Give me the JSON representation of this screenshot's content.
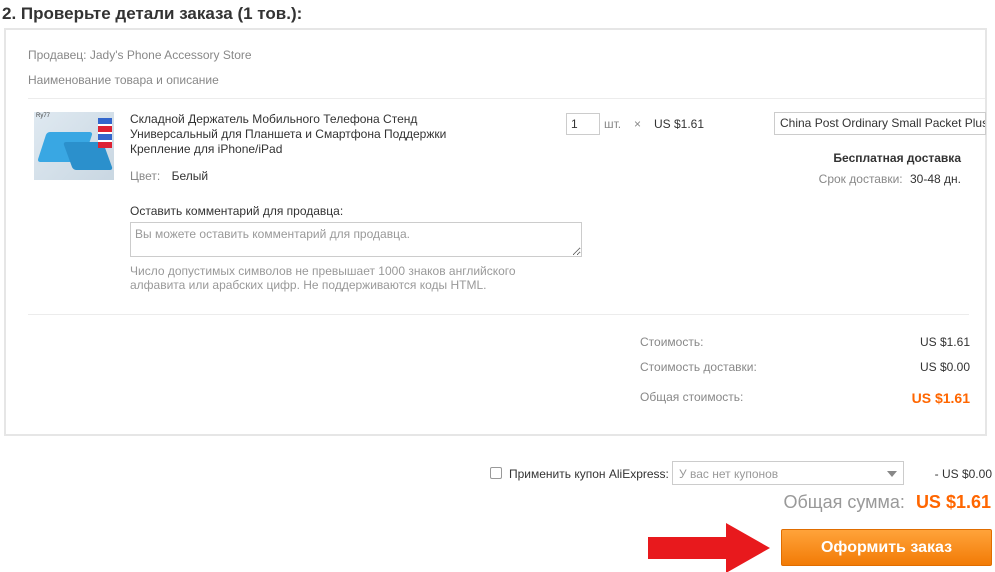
{
  "section": {
    "title": "2. Проверьте детали заказа (1 тов.):"
  },
  "order": {
    "seller": "Продавец: Jady's Phone Accessory Store",
    "name_header": "Наименование товара и описание",
    "product": {
      "title": "Складной Держатель Мобильного Телефона Стенд Универсальный для Планшета и Смартфона Поддержки Крепление для iPhone/iPad",
      "image_brand_text": "Ry77",
      "color_label": "Цвет:",
      "color_value": "Белый",
      "quantity": "1",
      "quantity_unit": "шт.",
      "times_sign": "×",
      "unit_price": "US $1.61"
    },
    "shipping": {
      "method": "China Post Ordinary Small Packet Plus",
      "free_label": "Бесплатная доставка",
      "delivery_label": "Срок доставки:",
      "delivery_value": "30-48 дн."
    },
    "comment": {
      "label": "Оставить комментарий для продавца:",
      "placeholder": "Вы можете оставить комментарий для продавца.",
      "hint": "Число допустимых символов не превышает 1000 знаков английского алфавита или арабских цифр. Не поддерживаются коды HTML."
    },
    "summary": {
      "cost_label": "Стоимость:",
      "cost_value": "US $1.61",
      "shipping_label": "Стоимость доставки:",
      "shipping_value": "US $0.00",
      "total_label": "Общая стоимость:",
      "total_value": "US $1.61"
    }
  },
  "coupon": {
    "label": "Применить купон AliExpress:",
    "select_value": "У вас нет купонов",
    "discount": "- US $0.00"
  },
  "grand_total": {
    "label": "Общая сумма:",
    "value": "US $1.61"
  },
  "checkout": {
    "button_label": "Оформить заказ"
  },
  "colors": {
    "accent_orange": "#f60",
    "button_top": "#ffa33a",
    "button_bottom": "#f27b06",
    "arrow_red": "#e8191d"
  }
}
